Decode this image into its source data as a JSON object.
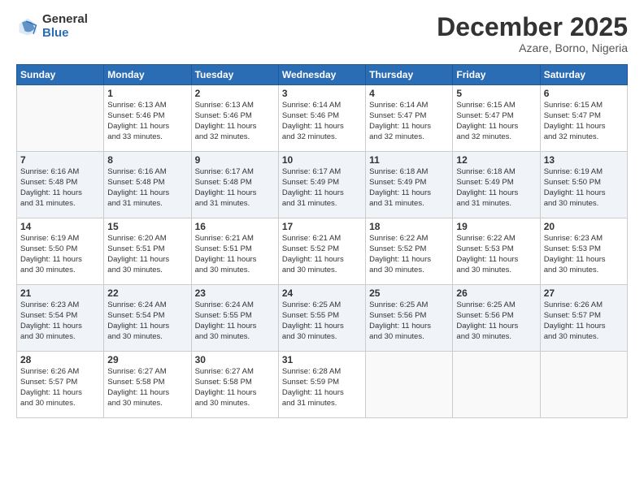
{
  "logo": {
    "general": "General",
    "blue": "Blue"
  },
  "header": {
    "month": "December 2025",
    "location": "Azare, Borno, Nigeria"
  },
  "days": [
    "Sunday",
    "Monday",
    "Tuesday",
    "Wednesday",
    "Thursday",
    "Friday",
    "Saturday"
  ],
  "weeks": [
    [
      {
        "day": "",
        "sunrise": "",
        "sunset": "",
        "daylight": ""
      },
      {
        "day": "1",
        "sunrise": "Sunrise: 6:13 AM",
        "sunset": "Sunset: 5:46 PM",
        "daylight": "Daylight: 11 hours and 33 minutes."
      },
      {
        "day": "2",
        "sunrise": "Sunrise: 6:13 AM",
        "sunset": "Sunset: 5:46 PM",
        "daylight": "Daylight: 11 hours and 32 minutes."
      },
      {
        "day": "3",
        "sunrise": "Sunrise: 6:14 AM",
        "sunset": "Sunset: 5:46 PM",
        "daylight": "Daylight: 11 hours and 32 minutes."
      },
      {
        "day": "4",
        "sunrise": "Sunrise: 6:14 AM",
        "sunset": "Sunset: 5:47 PM",
        "daylight": "Daylight: 11 hours and 32 minutes."
      },
      {
        "day": "5",
        "sunrise": "Sunrise: 6:15 AM",
        "sunset": "Sunset: 5:47 PM",
        "daylight": "Daylight: 11 hours and 32 minutes."
      },
      {
        "day": "6",
        "sunrise": "Sunrise: 6:15 AM",
        "sunset": "Sunset: 5:47 PM",
        "daylight": "Daylight: 11 hours and 32 minutes."
      }
    ],
    [
      {
        "day": "7",
        "sunrise": "Sunrise: 6:16 AM",
        "sunset": "Sunset: 5:48 PM",
        "daylight": "Daylight: 11 hours and 31 minutes."
      },
      {
        "day": "8",
        "sunrise": "Sunrise: 6:16 AM",
        "sunset": "Sunset: 5:48 PM",
        "daylight": "Daylight: 11 hours and 31 minutes."
      },
      {
        "day": "9",
        "sunrise": "Sunrise: 6:17 AM",
        "sunset": "Sunset: 5:48 PM",
        "daylight": "Daylight: 11 hours and 31 minutes."
      },
      {
        "day": "10",
        "sunrise": "Sunrise: 6:17 AM",
        "sunset": "Sunset: 5:49 PM",
        "daylight": "Daylight: 11 hours and 31 minutes."
      },
      {
        "day": "11",
        "sunrise": "Sunrise: 6:18 AM",
        "sunset": "Sunset: 5:49 PM",
        "daylight": "Daylight: 11 hours and 31 minutes."
      },
      {
        "day": "12",
        "sunrise": "Sunrise: 6:18 AM",
        "sunset": "Sunset: 5:49 PM",
        "daylight": "Daylight: 11 hours and 31 minutes."
      },
      {
        "day": "13",
        "sunrise": "Sunrise: 6:19 AM",
        "sunset": "Sunset: 5:50 PM",
        "daylight": "Daylight: 11 hours and 30 minutes."
      }
    ],
    [
      {
        "day": "14",
        "sunrise": "Sunrise: 6:19 AM",
        "sunset": "Sunset: 5:50 PM",
        "daylight": "Daylight: 11 hours and 30 minutes."
      },
      {
        "day": "15",
        "sunrise": "Sunrise: 6:20 AM",
        "sunset": "Sunset: 5:51 PM",
        "daylight": "Daylight: 11 hours and 30 minutes."
      },
      {
        "day": "16",
        "sunrise": "Sunrise: 6:21 AM",
        "sunset": "Sunset: 5:51 PM",
        "daylight": "Daylight: 11 hours and 30 minutes."
      },
      {
        "day": "17",
        "sunrise": "Sunrise: 6:21 AM",
        "sunset": "Sunset: 5:52 PM",
        "daylight": "Daylight: 11 hours and 30 minutes."
      },
      {
        "day": "18",
        "sunrise": "Sunrise: 6:22 AM",
        "sunset": "Sunset: 5:52 PM",
        "daylight": "Daylight: 11 hours and 30 minutes."
      },
      {
        "day": "19",
        "sunrise": "Sunrise: 6:22 AM",
        "sunset": "Sunset: 5:53 PM",
        "daylight": "Daylight: 11 hours and 30 minutes."
      },
      {
        "day": "20",
        "sunrise": "Sunrise: 6:23 AM",
        "sunset": "Sunset: 5:53 PM",
        "daylight": "Daylight: 11 hours and 30 minutes."
      }
    ],
    [
      {
        "day": "21",
        "sunrise": "Sunrise: 6:23 AM",
        "sunset": "Sunset: 5:54 PM",
        "daylight": "Daylight: 11 hours and 30 minutes."
      },
      {
        "day": "22",
        "sunrise": "Sunrise: 6:24 AM",
        "sunset": "Sunset: 5:54 PM",
        "daylight": "Daylight: 11 hours and 30 minutes."
      },
      {
        "day": "23",
        "sunrise": "Sunrise: 6:24 AM",
        "sunset": "Sunset: 5:55 PM",
        "daylight": "Daylight: 11 hours and 30 minutes."
      },
      {
        "day": "24",
        "sunrise": "Sunrise: 6:25 AM",
        "sunset": "Sunset: 5:55 PM",
        "daylight": "Daylight: 11 hours and 30 minutes."
      },
      {
        "day": "25",
        "sunrise": "Sunrise: 6:25 AM",
        "sunset": "Sunset: 5:56 PM",
        "daylight": "Daylight: 11 hours and 30 minutes."
      },
      {
        "day": "26",
        "sunrise": "Sunrise: 6:25 AM",
        "sunset": "Sunset: 5:56 PM",
        "daylight": "Daylight: 11 hours and 30 minutes."
      },
      {
        "day": "27",
        "sunrise": "Sunrise: 6:26 AM",
        "sunset": "Sunset: 5:57 PM",
        "daylight": "Daylight: 11 hours and 30 minutes."
      }
    ],
    [
      {
        "day": "28",
        "sunrise": "Sunrise: 6:26 AM",
        "sunset": "Sunset: 5:57 PM",
        "daylight": "Daylight: 11 hours and 30 minutes."
      },
      {
        "day": "29",
        "sunrise": "Sunrise: 6:27 AM",
        "sunset": "Sunset: 5:58 PM",
        "daylight": "Daylight: 11 hours and 30 minutes."
      },
      {
        "day": "30",
        "sunrise": "Sunrise: 6:27 AM",
        "sunset": "Sunset: 5:58 PM",
        "daylight": "Daylight: 11 hours and 30 minutes."
      },
      {
        "day": "31",
        "sunrise": "Sunrise: 6:28 AM",
        "sunset": "Sunset: 5:59 PM",
        "daylight": "Daylight: 11 hours and 31 minutes."
      },
      {
        "day": "",
        "sunrise": "",
        "sunset": "",
        "daylight": ""
      },
      {
        "day": "",
        "sunrise": "",
        "sunset": "",
        "daylight": ""
      },
      {
        "day": "",
        "sunrise": "",
        "sunset": "",
        "daylight": ""
      }
    ]
  ]
}
